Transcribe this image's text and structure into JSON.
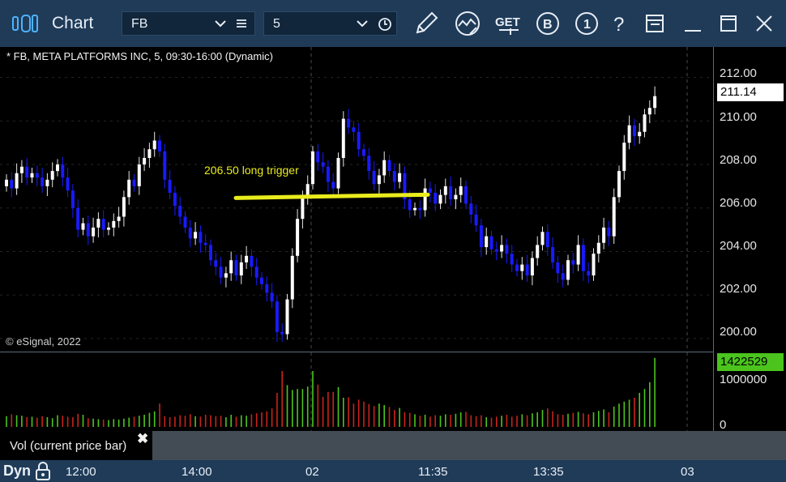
{
  "window": {
    "title": "Chart"
  },
  "toolbar": {
    "symbol": "FB",
    "interval": "5",
    "icons": [
      "pencil-icon",
      "indicator-icon",
      "get-icon",
      "buy-icon",
      "info-icon",
      "help-icon",
      "layout-icon",
      "minimize-icon",
      "maximize-icon",
      "close-icon"
    ]
  },
  "chart": {
    "symbol_line": "* FB, META PLATFORMS INC, 5, 09:30-16:00 (Dynamic)",
    "copyright": "© eSignal, 2022",
    "annotation": "206.50 long trigger",
    "last_price": "211.14",
    "last_volume": "1422529",
    "price_ticks": [
      "212.00",
      "210.00",
      "208.00",
      "206.00",
      "204.00",
      "202.00",
      "200.00"
    ],
    "volume_ticks": [
      "1000000",
      "0"
    ],
    "time_labels": [
      "12:00",
      "14:00",
      "02",
      "11:35",
      "13:35",
      "03"
    ]
  },
  "study": {
    "label": "Vol (current price bar)",
    "close": "✖"
  },
  "footer": {
    "mode": "Dyn"
  },
  "colors": {
    "up": "#ffffff",
    "down": "#1a1aff",
    "vol_up": "#4bc51d",
    "vol_down": "#c8241b",
    "annotation": "#e9ec1c"
  },
  "chart_data": {
    "type": "candlestick",
    "ylim": [
      199.4,
      213.4
    ],
    "close": [
      207.3,
      206.9,
      207.6,
      207.9,
      207.4,
      207.6,
      207.4,
      207.0,
      207.3,
      207.7,
      208.0,
      207.4,
      206.8,
      206.0,
      205.0,
      205.3,
      204.7,
      205.1,
      205.5,
      205.0,
      205.1,
      205.4,
      205.6,
      206.5,
      207.3,
      207.0,
      208.0,
      208.3,
      208.7,
      209.1,
      208.6,
      207.3,
      206.7,
      206.1,
      205.6,
      205.1,
      204.6,
      204.9,
      204.4,
      204.3,
      203.6,
      203.3,
      202.8,
      203.0,
      203.6,
      202.9,
      203.5,
      203.8,
      203.3,
      202.8,
      202.5,
      202.1,
      201.7,
      200.3,
      200.2,
      201.8,
      203.8,
      205.5,
      206.5,
      207.1,
      208.6,
      208.1,
      207.9,
      207.2,
      206.9,
      208.3,
      210.1,
      209.7,
      209.5,
      208.7,
      208.4,
      207.7,
      207.1,
      207.5,
      208.2,
      207.7,
      207.2,
      207.6,
      206.4,
      205.9,
      206.0,
      205.9,
      206.9,
      206.7,
      206.2,
      206.6,
      207.0,
      206.4,
      206.6,
      207.0,
      206.2,
      205.7,
      205.2,
      204.2,
      204.7,
      204.1,
      204.0,
      204.3,
      203.9,
      203.4,
      203.1,
      203.4,
      202.9,
      203.7,
      204.3,
      204.9,
      204.2,
      203.5,
      203.0,
      202.7,
      203.6,
      203.4,
      204.3,
      203.1,
      202.9,
      203.9,
      204.4,
      205.1,
      204.7,
      206.5,
      207.7,
      209.0,
      209.8,
      209.3,
      209.5,
      210.3,
      210.6,
      211.14
    ],
    "volume": [
      220000,
      260000,
      240000,
      230000,
      200000,
      210000,
      190000,
      220000,
      200000,
      180000,
      240000,
      230000,
      210000,
      200000,
      270000,
      250000,
      180000,
      170000,
      160000,
      150000,
      140000,
      160000,
      150000,
      170000,
      190000,
      210000,
      230000,
      250000,
      290000,
      320000,
      480000,
      220000,
      200000,
      210000,
      240000,
      230000,
      260000,
      220000,
      210000,
      250000,
      240000,
      220000,
      230000,
      200000,
      250000,
      210000,
      240000,
      230000,
      260000,
      280000,
      300000,
      320000,
      380000,
      700000,
      1150000,
      860000,
      760000,
      780000,
      780000,
      830000,
      1150000,
      870000,
      620000,
      720000,
      720000,
      820000,
      600000,
      610000,
      480000,
      560000,
      520000,
      470000,
      430000,
      480000,
      450000,
      410000,
      350000,
      390000,
      300000,
      290000,
      260000,
      230000,
      250000,
      210000,
      240000,
      230000,
      260000,
      250000,
      270000,
      300000,
      310000,
      240000,
      220000,
      240000,
      200000,
      190000,
      210000,
      230000,
      250000,
      210000,
      230000,
      260000,
      240000,
      280000,
      300000,
      350000,
      380000,
      320000,
      260000,
      250000,
      270000,
      290000,
      310000,
      280000,
      260000,
      300000,
      330000,
      360000,
      300000,
      420000,
      480000,
      520000,
      560000,
      600000,
      700000,
      780000,
      920000,
      1420000
    ]
  }
}
